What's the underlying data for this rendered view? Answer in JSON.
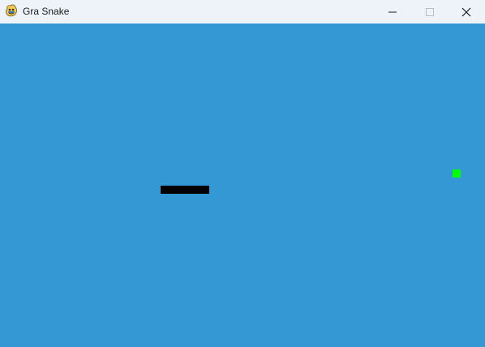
{
  "window": {
    "title": "Gra Snake",
    "icon": "pygame-snake-icon",
    "controls": {
      "minimize": "minimize-icon",
      "maximize": "maximize-icon",
      "close": "close-icon"
    }
  },
  "colors": {
    "titlebar": "#edf3f8",
    "board": "#3498d5",
    "snake": "#000000",
    "food": "#00ff00"
  },
  "game": {
    "snake_length": 6,
    "food_count": 1
  }
}
